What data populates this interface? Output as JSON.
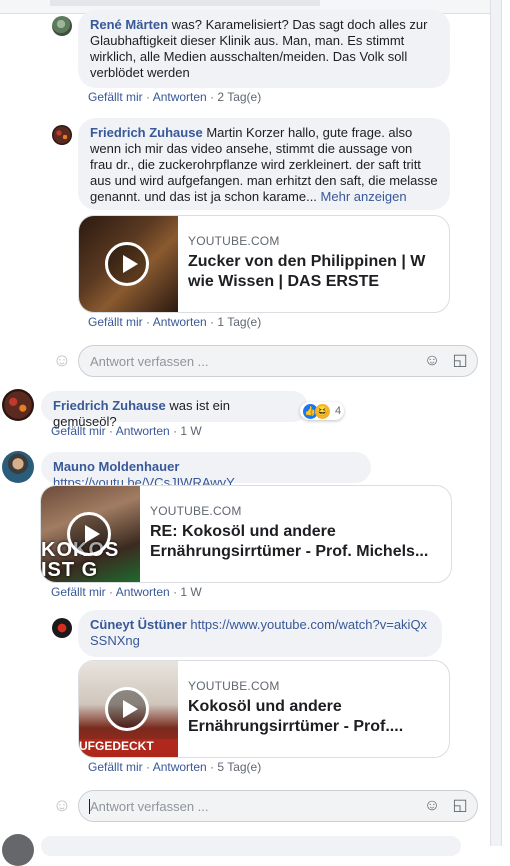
{
  "comments": [
    {
      "author": "René Märten",
      "text": "was? Karamelisiert? Das sagt doch alles zur Glaubhaftigkeit dieser Klinik aus. Man, man. Es stimmt wirklich, alle Medien ausschalten/meiden. Das Volk soll verblödet werden",
      "like": "Gefällt mir",
      "reply": "Antworten",
      "time": "2 Tag(e)"
    },
    {
      "author": "Friedrich Zuhause",
      "text": "Martin Korzer hallo, gute frage. also wenn ich mir das video ansehe, stimmt die aussage von frau dr., die zuckerohrpflanze wird zerkleinert. der saft tritt aus und wird aufgefangen. man erhitzt den saft, die melasse genannt. und das ist ja schon karame...",
      "more": "Mehr anzeigen",
      "card": {
        "domain": "YOUTUBE.COM",
        "title": "Zucker von den Philippinen | W wie Wissen | DAS ERSTE"
      },
      "like": "Gefällt mir",
      "reply": "Antworten",
      "time": "1 Tag(e)"
    },
    {
      "author": "Friedrich Zuhause",
      "text": "was ist ein gemüseöl?",
      "reactions_count": "4",
      "like": "Gefällt mir",
      "reply": "Antworten",
      "time": "1 W"
    },
    {
      "author": "Mauno Moldenhauer",
      "link": "https://youtu.be/VCsJIWRAwyY",
      "card": {
        "domain": "YOUTUBE.COM",
        "title": "RE: Kokosöl und andere Ernährungsirrtümer - Prof. Michels...",
        "thumb_text": "KOKOS IST G"
      },
      "like": "Gefällt mir",
      "reply": "Antworten",
      "time": "1 W"
    },
    {
      "author": "Cüneyt Üstüner",
      "link": "https://www.youtube.com/watch?v=akiQxSSNXng",
      "card": {
        "domain": "YOUTUBE.COM",
        "title": "Kokosöl und andere Ernährungsirrtümer - Prof....",
        "thumb_text": "UFGEDECKT"
      },
      "like": "Gefällt mir",
      "reply": "Antworten",
      "time": "5 Tag(e)"
    }
  ],
  "reply_box": {
    "placeholder": "Antwort verfassen ..."
  },
  "separator": "·",
  "icons": {
    "emoji": "smiley-icon",
    "sticker": "sticker-icon",
    "play": "play-icon"
  },
  "colors": {
    "link": "#385898",
    "bubble": "#f0f2f5",
    "meta": "#606770"
  }
}
